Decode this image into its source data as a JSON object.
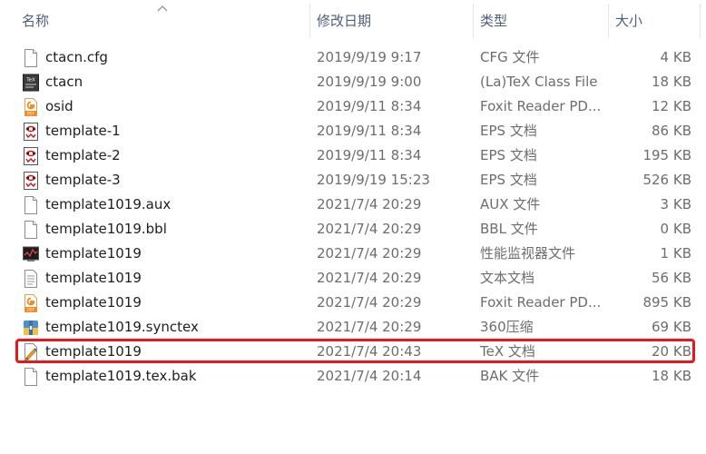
{
  "columns": {
    "name": "名称",
    "date": "修改日期",
    "type": "类型",
    "size": "大小"
  },
  "files": [
    {
      "name": "ctacn.cfg",
      "date": "2019/9/19 9:17",
      "type": "CFG 文件",
      "size": "4 KB",
      "icon": "blank-file-icon"
    },
    {
      "name": "ctacn",
      "date": "2019/9/19 9:00",
      "type": "(La)TeX Class File",
      "size": "18 KB",
      "icon": "tex-class-icon"
    },
    {
      "name": "osid",
      "date": "2019/9/11 8:34",
      "type": "Foxit Reader PD...",
      "size": "12 KB",
      "icon": "pdf-icon"
    },
    {
      "name": "template-1",
      "date": "2019/9/11 8:34",
      "type": "EPS 文档",
      "size": "86 KB",
      "icon": "eps-icon"
    },
    {
      "name": "template-2",
      "date": "2019/9/11 8:34",
      "type": "EPS 文档",
      "size": "195 KB",
      "icon": "eps-icon"
    },
    {
      "name": "template-3",
      "date": "2019/9/19 15:23",
      "type": "EPS 文档",
      "size": "526 KB",
      "icon": "eps-icon"
    },
    {
      "name": "template1019.aux",
      "date": "2021/7/4 20:29",
      "type": "AUX 文件",
      "size": "3 KB",
      "icon": "blank-file-icon"
    },
    {
      "name": "template1019.bbl",
      "date": "2021/7/4 20:29",
      "type": "BBL 文件",
      "size": "0 KB",
      "icon": "blank-file-icon"
    },
    {
      "name": "template1019",
      "date": "2021/7/4 20:29",
      "type": "性能监视器文件",
      "size": "1 KB",
      "icon": "perfmon-icon"
    },
    {
      "name": "template1019",
      "date": "2021/7/4 20:29",
      "type": "文本文档",
      "size": "56 KB",
      "icon": "text-file-icon"
    },
    {
      "name": "template1019",
      "date": "2021/7/4 20:29",
      "type": "Foxit Reader PD...",
      "size": "895 KB",
      "icon": "pdf-icon"
    },
    {
      "name": "template1019.synctex",
      "date": "2021/7/4 20:29",
      "type": "360压缩",
      "size": "69 KB",
      "icon": "archive-icon"
    },
    {
      "name": "template1019",
      "date": "2021/7/4 20:43",
      "type": "TeX 文档",
      "size": "20 KB",
      "icon": "tex-doc-icon",
      "highlighted": true
    },
    {
      "name": "template1019.tex.bak",
      "date": "2021/7/4 20:14",
      "type": "BAK 文件",
      "size": "18 KB",
      "icon": "blank-file-icon"
    }
  ],
  "colors": {
    "highlight": "#e8171b",
    "header_text": "#4c607a",
    "pdf_orange": "#f08a1e",
    "eps_red": "#c9141a"
  }
}
